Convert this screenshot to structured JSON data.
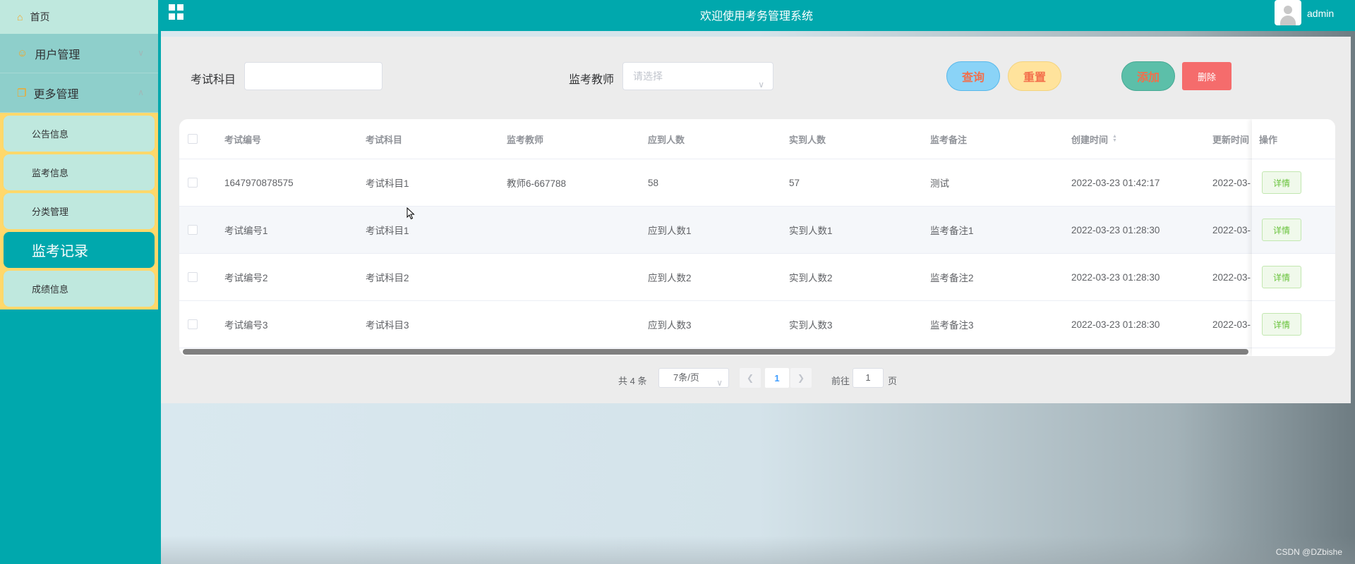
{
  "sidebar": {
    "home": "首页",
    "user_mgmt": "用户管理",
    "more_mgmt": "更多管理",
    "sub_items": [
      "公告信息",
      "监考信息",
      "分类管理",
      "监考记录",
      "成绩信息"
    ],
    "active_index": 3
  },
  "header": {
    "title": "欢迎使用考务管理系统",
    "username": "admin"
  },
  "search": {
    "subject_label": "考试科目",
    "subject_value": "",
    "teacher_label": "监考教师",
    "teacher_placeholder": "请选择",
    "query_button": "查询",
    "reset_button": "重置",
    "add_button": "添加",
    "delete_button": "删除"
  },
  "table": {
    "columns": [
      "考试编号",
      "考试科目",
      "监考教师",
      "应到人数",
      "实到人数",
      "监考备注",
      "创建时间",
      "更新时间"
    ],
    "op_header": "操作",
    "detail_label": "详情",
    "rows": [
      [
        "1647970878575",
        "考试科目1",
        "教师6-667788",
        "58",
        "57",
        "测试",
        "2022-03-23 01:42:17",
        "2022-03-"
      ],
      [
        "考试编号1",
        "考试科目1",
        "",
        "应到人数1",
        "实到人数1",
        "监考备注1",
        "2022-03-23 01:28:30",
        "2022-03-"
      ],
      [
        "考试编号2",
        "考试科目2",
        "",
        "应到人数2",
        "实到人数2",
        "监考备注2",
        "2022-03-23 01:28:30",
        "2022-03-"
      ],
      [
        "考试编号3",
        "考试科目3",
        "",
        "应到人数3",
        "实到人数3",
        "监考备注3",
        "2022-03-23 01:28:30",
        "2022-03-"
      ]
    ]
  },
  "pagination": {
    "total": "共 4 条",
    "page_size": "7条/页",
    "current_page": "1",
    "goto_label": "前往",
    "jump_value": "1",
    "page_unit": "页"
  },
  "watermark": "CSDN @DZbishe",
  "colors": {
    "primary": "#00a8ad",
    "sidebar_item": "#bfe8de",
    "submenu_bg": "#ffd86b",
    "delete": "#f56c6c"
  }
}
